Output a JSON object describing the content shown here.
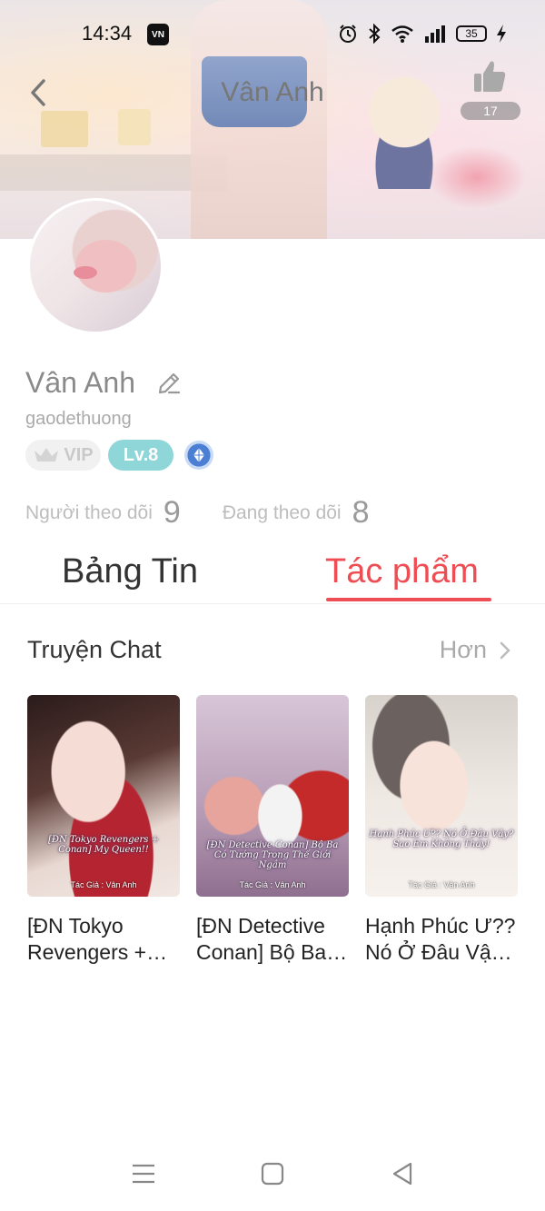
{
  "status_bar": {
    "time": "14:34",
    "app_icon_text": "VN",
    "battery": "35",
    "icons": [
      "alarm-icon",
      "bluetooth-icon",
      "wifi-icon",
      "signal-icon",
      "battery-icon",
      "charging-icon"
    ]
  },
  "header": {
    "title": "Vân Anh",
    "like_count": "17"
  },
  "profile": {
    "name": "Vân Anh",
    "username": "gaodethuong",
    "badges": {
      "vip": "VIP",
      "level": "Lv.8"
    },
    "followers_label": "Người theo dõi",
    "followers_count": "9",
    "following_label": "Đang theo dõi",
    "following_count": "8"
  },
  "tabs": [
    {
      "label": "Bảng Tin",
      "active": false
    },
    {
      "label": "Tác phẩm",
      "active": true
    }
  ],
  "section": {
    "title": "Truyện Chat",
    "more_label": "Hơn"
  },
  "works": [
    {
      "title": "[ĐN Tokyo Revengers + Conan] My Queen!!",
      "cover_caption": "[ĐN Tokyo Revengers + Conan] My Queen!!",
      "cover_author": "Tác Giả : Vân Anh"
    },
    {
      "title": "[ĐN Detective Conan] Bộ Ba Có Tướng Trong Thế Giới Ngầm",
      "cover_caption": "[ĐN Detective Conan] Bộ Ba Có Tướng Trong Thế Giới Ngầm",
      "cover_author": "Tác Giả : Vân Anh"
    },
    {
      "title": "Hạnh Phúc Ư?? Nó Ở Đâu Vậy? Sao Em Không Thấy!",
      "cover_caption": "Hạnh Phúc Ư?? Nó Ở Đâu Vậy? Sao Em Không Thấy!",
      "cover_author": "Tác Giả : Vân Anh"
    }
  ],
  "colors": {
    "accent": "#ef4d54",
    "level_badge": "#8fd6d9",
    "muted_text": "#aaaaaa"
  }
}
